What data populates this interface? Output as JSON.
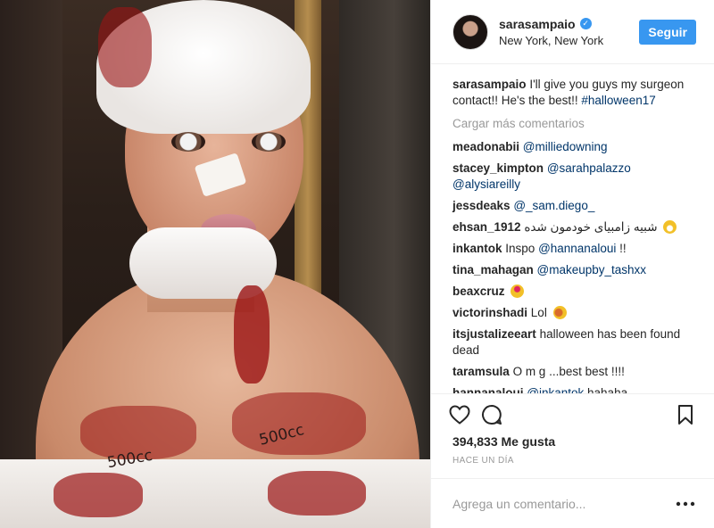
{
  "post": {
    "username": "sarasampaio",
    "location": "New York, New York",
    "follow_label": "Seguir",
    "caption_user": "sarasampaio",
    "caption_text": " I'll give you guys my surgeon contact!! He's the best!! ",
    "caption_tag": "#halloween17",
    "load_more": "Cargar más comentarios",
    "likes": "394,833 Me gusta",
    "time_ago": "HACE UN DÍA",
    "comment_placeholder": "Agrega un comentario...",
    "image_text": {
      "left_cc": "500cc",
      "right_cc": "500cc"
    }
  },
  "comments": [
    {
      "user": "meadonabii",
      "text": "",
      "mention": "@milliedowning",
      "after": ""
    },
    {
      "user": "stacey_kimpton",
      "text": "",
      "mention": "@sarahpalazzo",
      "after": ""
    },
    {
      "user": "",
      "text": "",
      "mention": "@alysiareilly",
      "after": ""
    },
    {
      "user": "jessdeaks",
      "text": "",
      "mention": "@_sam.diego_",
      "after": ""
    },
    {
      "user": "ehsan_1912",
      "text": "شبیه زامبیای خودمون شده",
      "mention": "",
      "after": ""
    },
    {
      "user": "inkantok",
      "text": "Inspo ",
      "mention": "@hannanaloui",
      "after": " !!"
    },
    {
      "user": "tina_mahagan",
      "text": "",
      "mention": "@makeupby_tashxx",
      "after": ""
    },
    {
      "user": "beaxcruz",
      "text": "",
      "mention": "",
      "after": ""
    },
    {
      "user": "victorinshadi",
      "text": "Lol",
      "mention": "",
      "after": ""
    },
    {
      "user": "itsjustalizeeart",
      "text": "halloween has been found dead",
      "mention": "",
      "after": ""
    },
    {
      "user": "taramsula",
      "text": "O m g ...best best !!!!",
      "mention": "",
      "after": ""
    },
    {
      "user": "hannanaloui",
      "text": "",
      "mention": "@inkantok",
      "after": " hahaha"
    }
  ],
  "colors": {
    "accent": "#3897f0",
    "link": "#003569",
    "muted": "#999999"
  },
  "icons": [
    "verified-badge-icon",
    "heart-icon",
    "comment-icon",
    "bookmark-icon",
    "more-options-icon"
  ]
}
